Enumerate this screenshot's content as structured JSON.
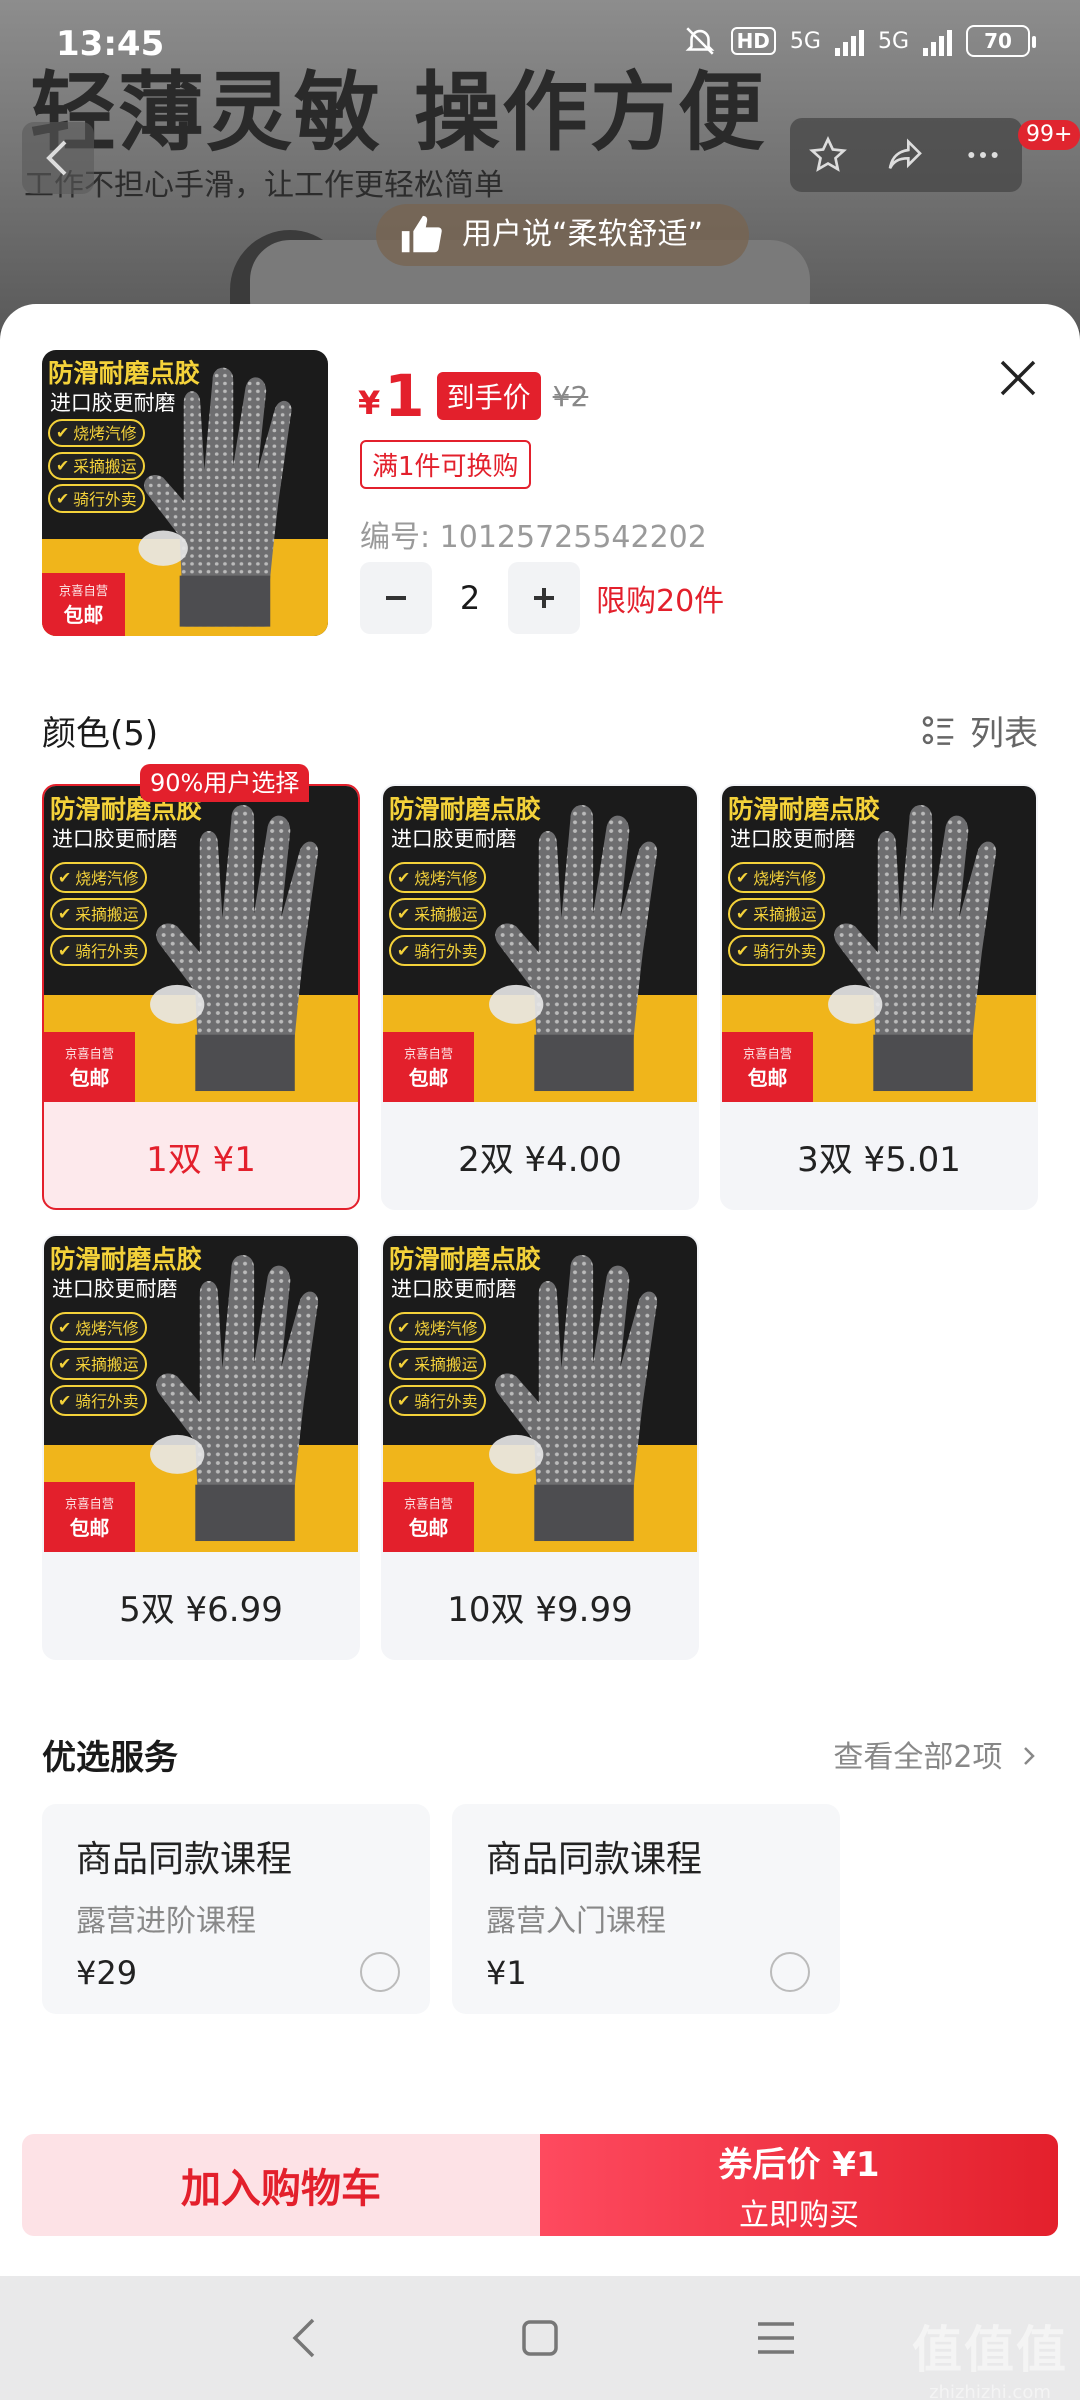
{
  "status_bar": {
    "time": "13:45",
    "hd": "HD",
    "net1": "5G",
    "net2": "5G",
    "battery": "70"
  },
  "background": {
    "headline": "轻薄灵敏 操作方便",
    "subline": "工作不担心手滑，让工作更轻松简单",
    "user_review": "用户说“柔软舒适”",
    "cart_badge": "99+"
  },
  "product": {
    "currency": "¥",
    "price": "1",
    "price_tag": "到手价",
    "original_price": "¥2",
    "exchange_tag": "满1件可换购",
    "sku_number": "编号: 10125725542202",
    "quantity": "2",
    "purchase_limit": "限购20件"
  },
  "product_image": {
    "title": "防滑耐磨点胶",
    "subtitle": "进口胶更耐磨",
    "features": [
      "烧烤汽修",
      "采摘搬运",
      "骑行外卖"
    ],
    "stamp_top": "京喜自营",
    "stamp_bottom": "包邮"
  },
  "colors": {
    "title": "颜色(5)",
    "list_label": "列表",
    "top_choice_badge": "90%用户选择",
    "options": [
      {
        "label": "1双 ¥1",
        "selected": true
      },
      {
        "label": "2双 ¥4.00",
        "selected": false
      },
      {
        "label": "3双 ¥5.01",
        "selected": false
      },
      {
        "label": "5双 ¥6.99",
        "selected": false
      },
      {
        "label": "10双 ¥9.99",
        "selected": false
      }
    ]
  },
  "services": {
    "title": "优选服务",
    "view_all": "查看全部2项",
    "items": [
      {
        "title": "商品同款课程",
        "subtitle": "露营进阶课程",
        "price": "¥29"
      },
      {
        "title": "商品同款课程",
        "subtitle": "露营入门课程",
        "price": "¥1"
      }
    ]
  },
  "actions": {
    "add_to_cart": "加入购物车",
    "coupon_price": "券后价 ¥1",
    "buy_now": "立即购买"
  },
  "watermark": {
    "mark": "值值值",
    "url": "zhizhizhi.com"
  },
  "colors_theme": {
    "accent": "#e3202c",
    "accent_light": "#fde2e6"
  }
}
